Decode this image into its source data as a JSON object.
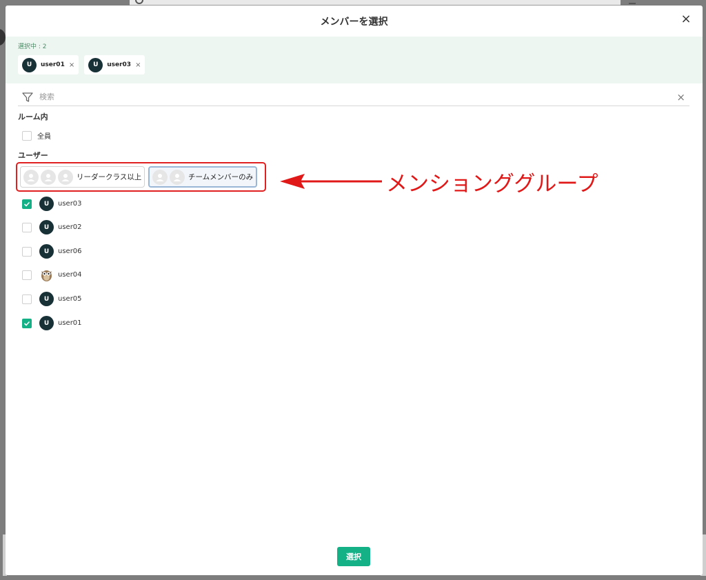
{
  "modal": {
    "title": "メンバーを選択",
    "close": "×",
    "selected_label": "選択中 : 2",
    "selected_chips": [
      {
        "initial": "U",
        "name": "user01",
        "remove": "×"
      },
      {
        "initial": "U",
        "name": "user03",
        "remove": "×"
      }
    ],
    "search": {
      "placeholder": "検索",
      "clear": "×"
    },
    "room_section": {
      "title": "ルーム内",
      "all_label": "全員",
      "all_checked": false
    },
    "user_section": {
      "title": "ユーザー"
    },
    "mention_groups": [
      {
        "label": "リーダークラス以上",
        "avatar_count": 3,
        "active": false
      },
      {
        "label": "チームメンバーのみ",
        "avatar_count": 2,
        "active": true
      }
    ],
    "users": [
      {
        "name": "user03",
        "initial": "U",
        "checked": true,
        "avatar": "initial"
      },
      {
        "name": "user02",
        "initial": "U",
        "checked": false,
        "avatar": "initial"
      },
      {
        "name": "user06",
        "initial": "U",
        "checked": false,
        "avatar": "initial"
      },
      {
        "name": "user04",
        "initial": "",
        "checked": false,
        "avatar": "owl-icon"
      },
      {
        "name": "user05",
        "initial": "U",
        "checked": false,
        "avatar": "initial"
      },
      {
        "name": "user01",
        "initial": "U",
        "checked": true,
        "avatar": "initial"
      }
    ],
    "submit_label": "選択"
  },
  "annotation": {
    "text": "メンションググループ"
  },
  "colors": {
    "accent": "#14b086",
    "avatar_bg": "#183137",
    "annotation": "#e01818",
    "selected_panel_bg": "#eef6f1"
  }
}
